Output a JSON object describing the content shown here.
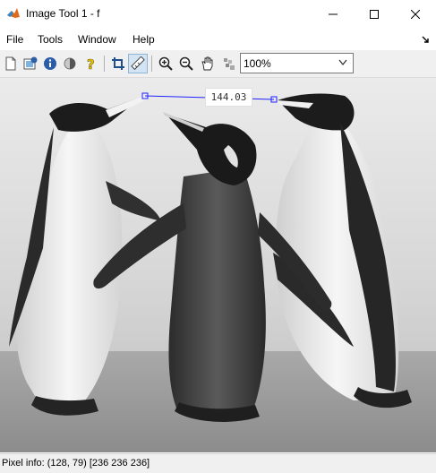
{
  "window": {
    "title": "Image Tool 1 - f",
    "controls": [
      "minimize",
      "maximize",
      "close"
    ]
  },
  "menu": {
    "items": [
      "File",
      "Tools",
      "Window",
      "Help"
    ]
  },
  "toolbar": {
    "buttons": [
      {
        "name": "new-window",
        "icon": "document-icon"
      },
      {
        "name": "image-info",
        "icon": "image-info-icon"
      },
      {
        "name": "information",
        "icon": "info-icon"
      },
      {
        "name": "contrast",
        "icon": "contrast-icon"
      },
      {
        "name": "help",
        "icon": "question-icon"
      },
      {
        "name": "crop",
        "icon": "crop-icon"
      },
      {
        "name": "distance",
        "icon": "ruler-icon",
        "pressed": true
      },
      {
        "name": "zoom-in",
        "icon": "zoom-in-icon"
      },
      {
        "name": "zoom-out",
        "icon": "zoom-out-icon"
      },
      {
        "name": "pan",
        "icon": "hand-icon"
      },
      {
        "name": "pixel-region",
        "icon": "pixel-region-icon"
      }
    ],
    "zoom": "100%"
  },
  "measurement": {
    "label": "144.03",
    "line_color": "#2020ff"
  },
  "status": {
    "pixel_info": "Pixel info: (128, 79)  [236 236 236]"
  },
  "colors": {
    "matlab_orange": "#e06a1a",
    "pressed_bg": "#d3e5f5"
  }
}
